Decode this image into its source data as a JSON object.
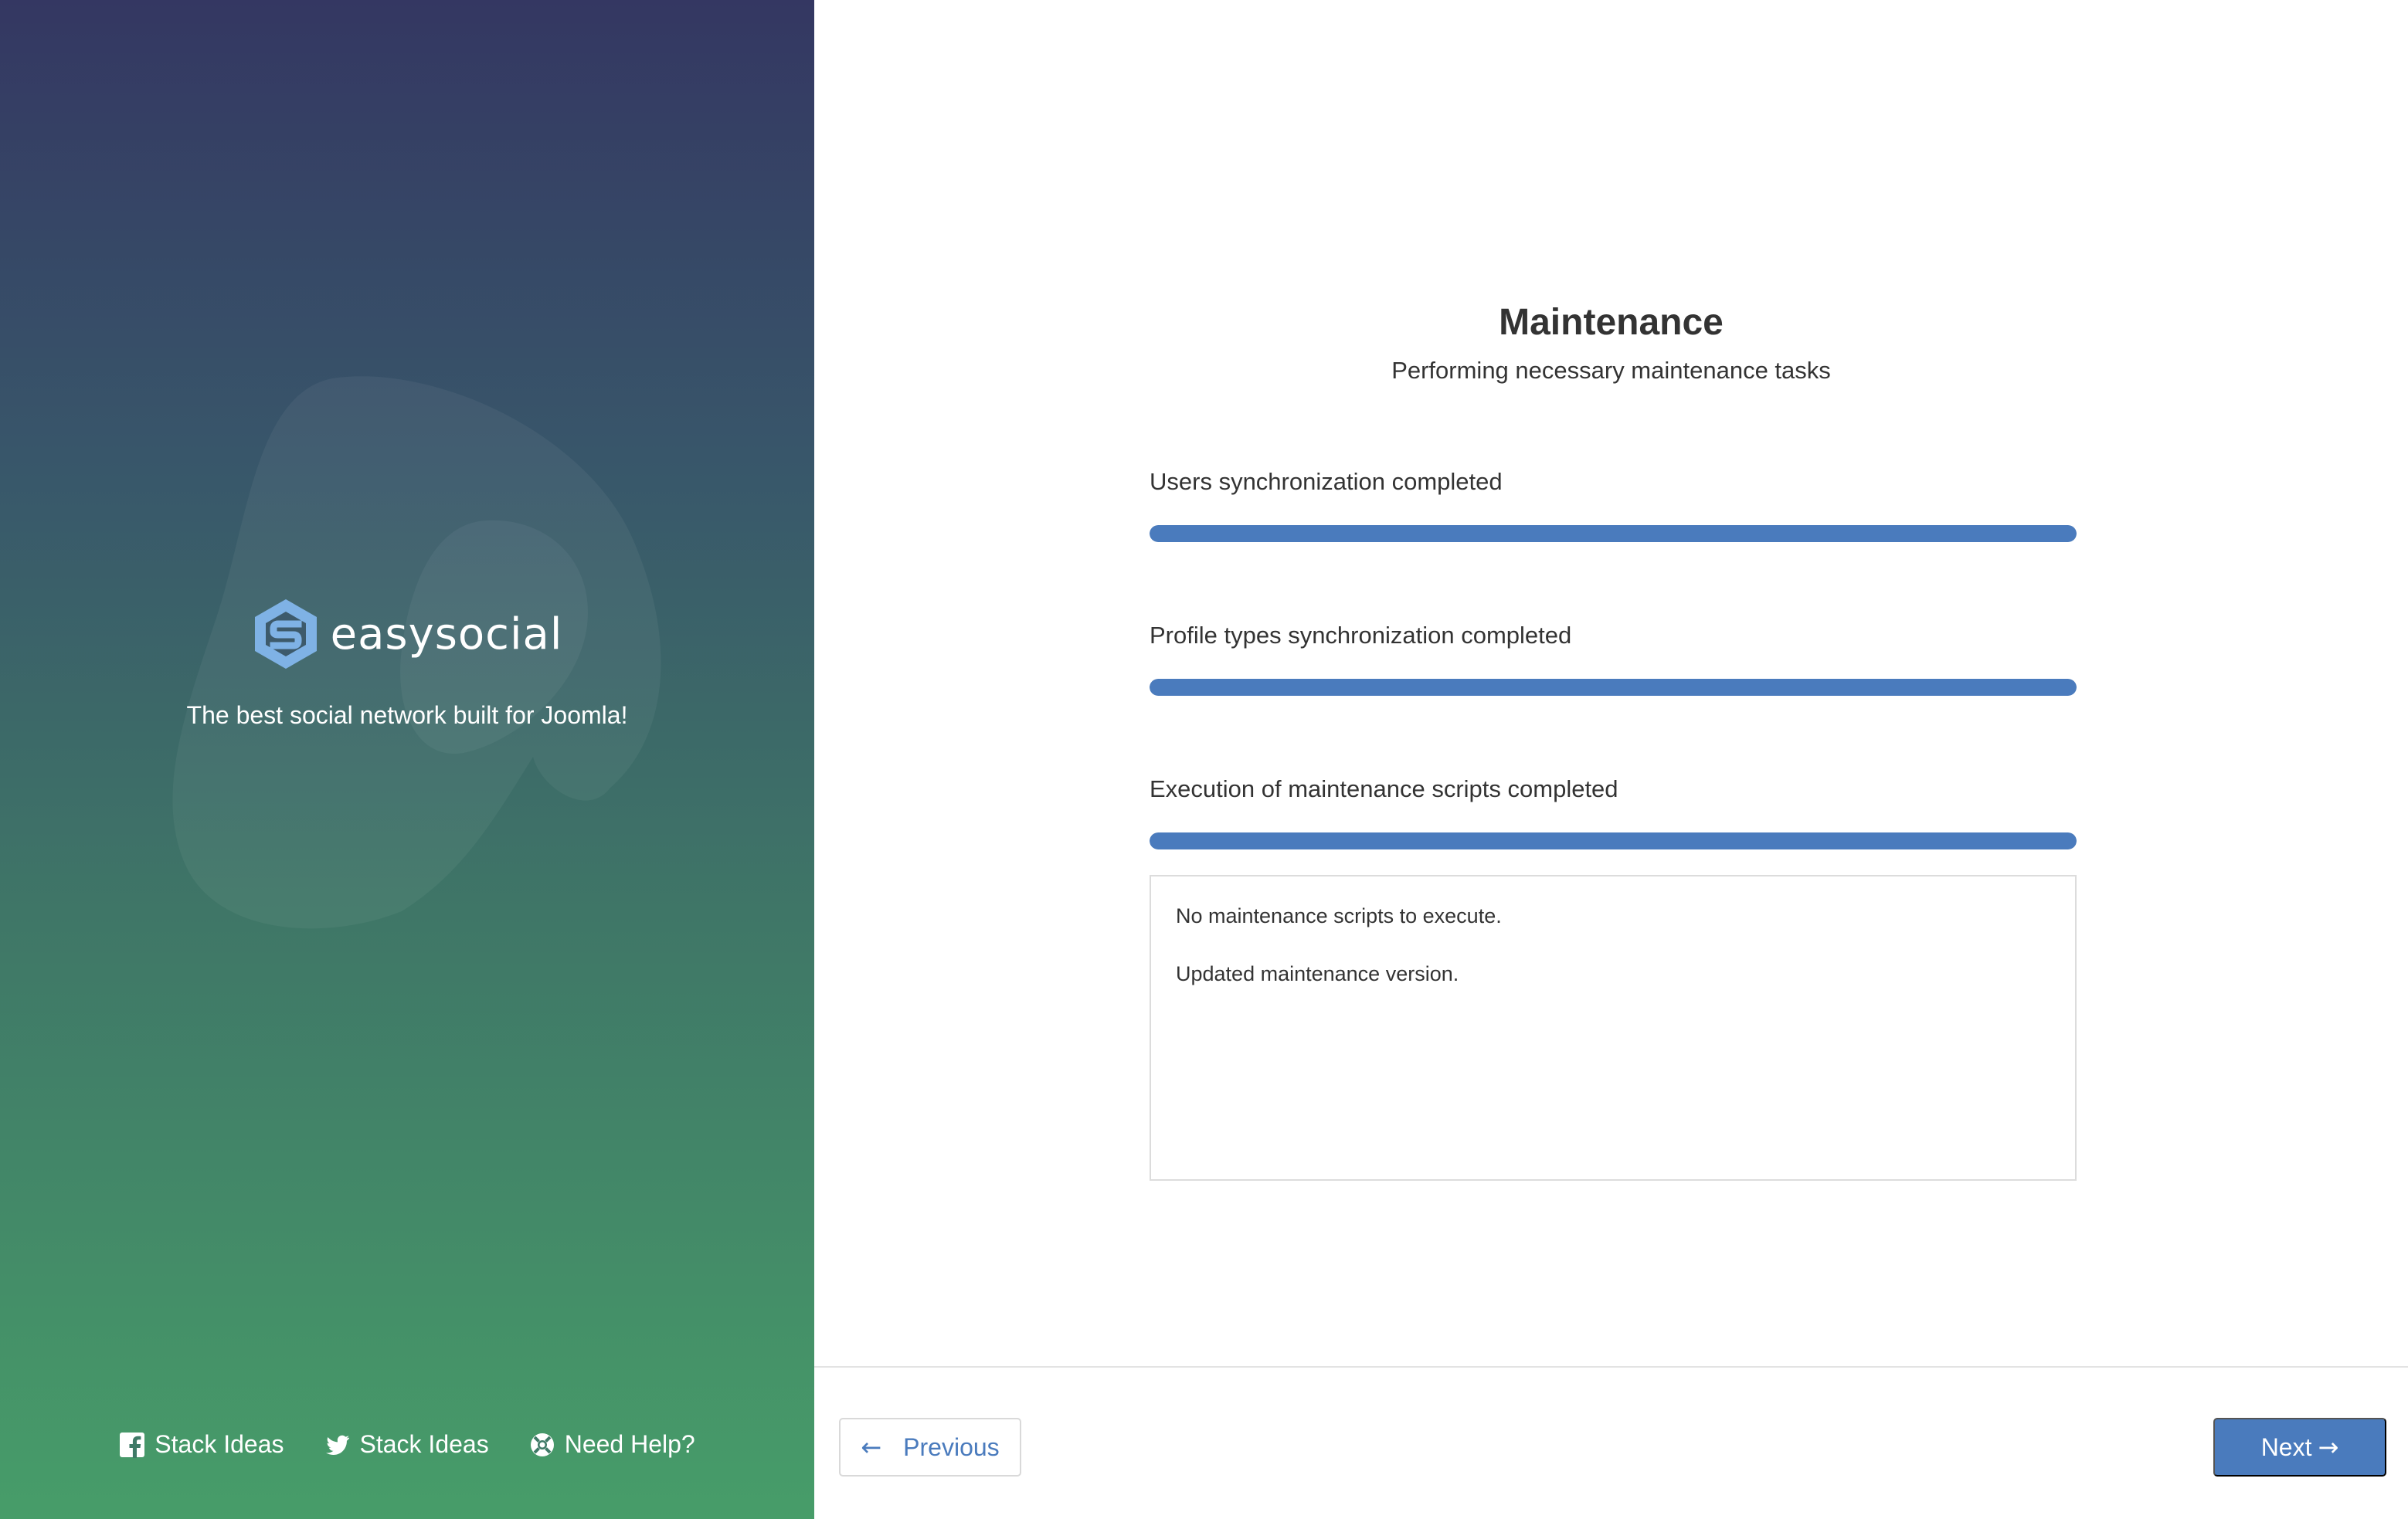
{
  "sidebar": {
    "brand_name": "easysocial",
    "tagline": "The best social network built for Joomla!",
    "links": [
      {
        "icon": "facebook-icon",
        "label": "Stack Ideas"
      },
      {
        "icon": "twitter-icon",
        "label": "Stack Ideas"
      },
      {
        "icon": "lifebuoy-icon",
        "label": "Need Help?"
      }
    ]
  },
  "main": {
    "title": "Maintenance",
    "subtitle": "Performing necessary maintenance tasks",
    "tasks": [
      {
        "label": "Users synchronization completed",
        "progress": 1.0
      },
      {
        "label": "Profile types synchronization completed",
        "progress": 1.0
      },
      {
        "label": "Execution of maintenance scripts completed",
        "progress": 1.0
      }
    ],
    "log": [
      "No maintenance scripts to execute.",
      "Updated maintenance version."
    ]
  },
  "footer": {
    "previous_label": "Previous",
    "previous_arrow": "←",
    "next_label": "Next",
    "next_arrow": "→"
  },
  "colors": {
    "accent": "#4a7bbd",
    "sidebar_top": "#343762",
    "sidebar_bottom": "#479d69"
  }
}
